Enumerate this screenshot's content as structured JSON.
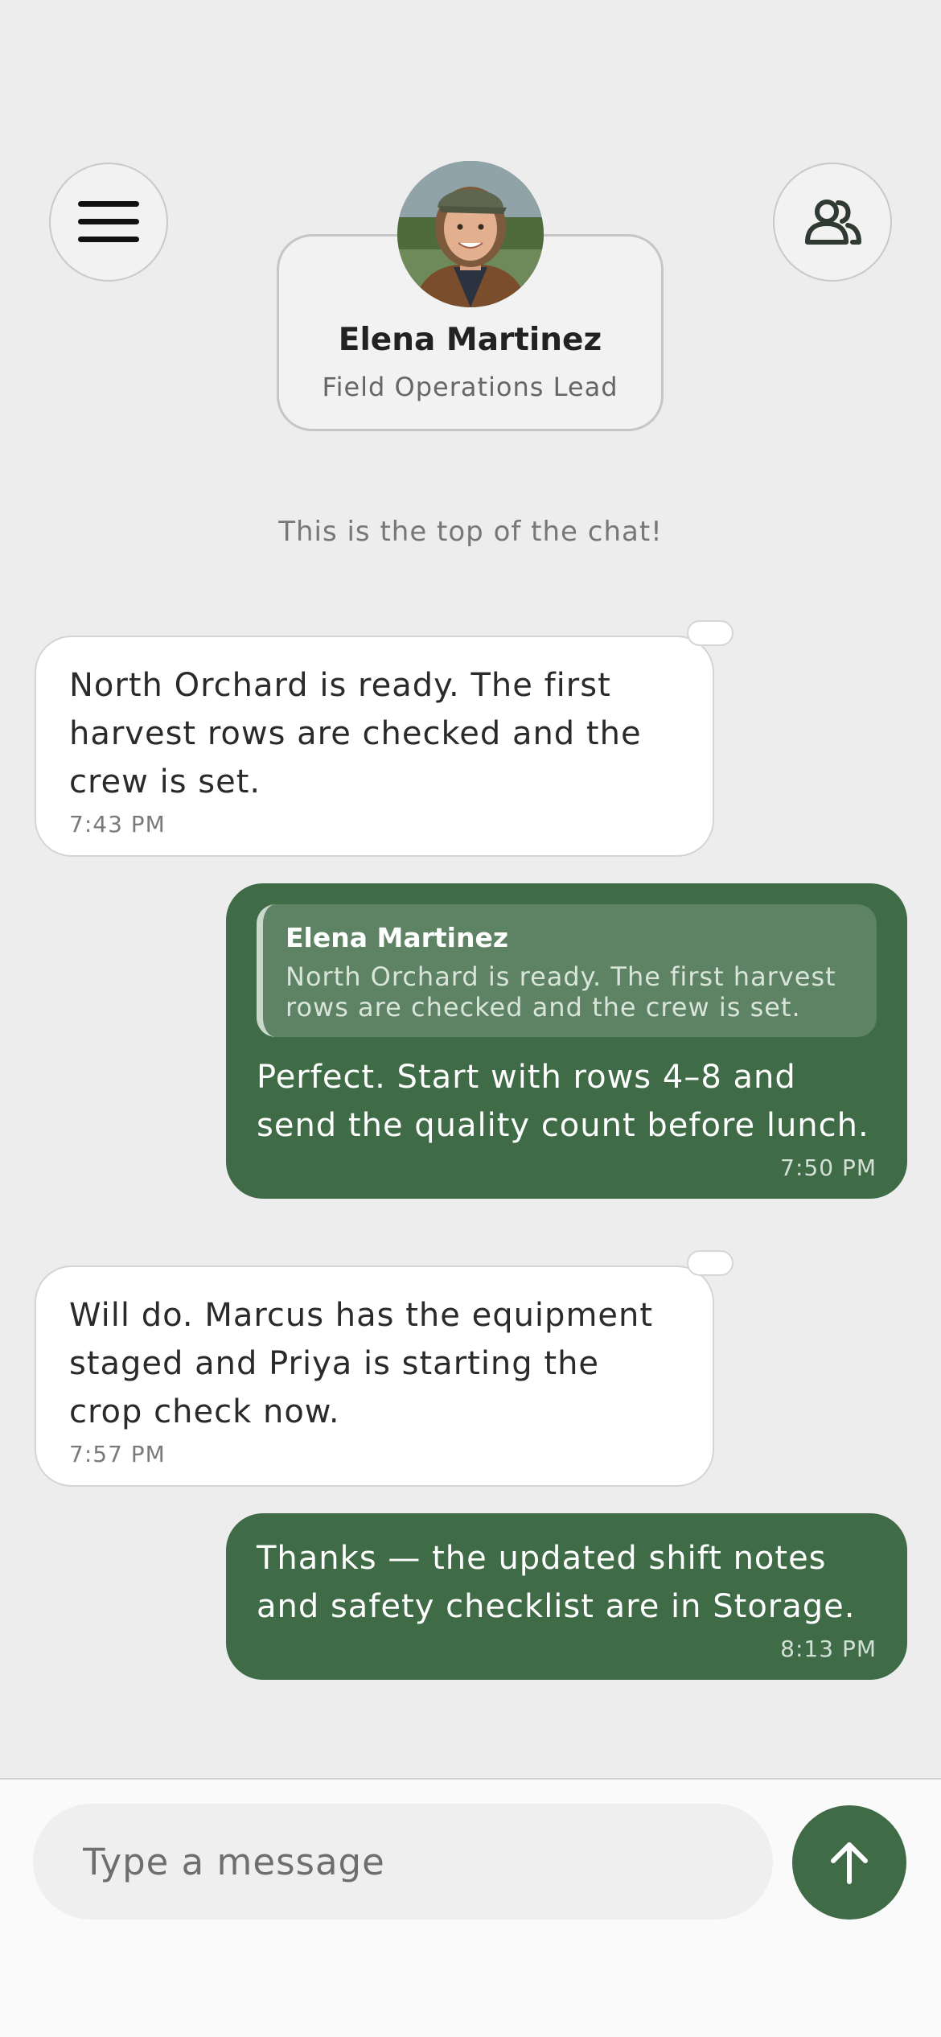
{
  "header": {
    "menu_icon": "hamburger-menu-icon",
    "people_icon": "people-icon",
    "contact": {
      "name": "Elena Martinez",
      "role": "Field Operations Lead"
    }
  },
  "chat_top_note": "This is the top of the chat!",
  "messages": [
    {
      "direction": "incoming",
      "text": "North Orchard is ready. The first harvest rows are checked and the crew is set.",
      "time": "7:43 PM"
    },
    {
      "direction": "outgoing",
      "quote": {
        "name": "Elena Martinez",
        "text": "North Orchard is ready. The first harvest rows are checked and the crew is set."
      },
      "text": "Perfect. Start with rows 4–8 and send the quality count before lunch.",
      "time": "7:50 PM"
    },
    {
      "direction": "incoming",
      "text": "Will do. Marcus has the equipment staged and Priya is starting the crop check now.",
      "time": "7:57 PM"
    },
    {
      "direction": "outgoing",
      "text": "Thanks — the updated shift notes and safety checklist are in Storage.",
      "time": "8:13 PM"
    }
  ],
  "composer": {
    "placeholder": "Type a message",
    "send_icon": "arrow-up-icon"
  },
  "colors": {
    "background": "#ededed",
    "outgoing_bubble": "#3f6b47",
    "incoming_bubble": "#ffffff",
    "send_button": "#3f6b47"
  }
}
